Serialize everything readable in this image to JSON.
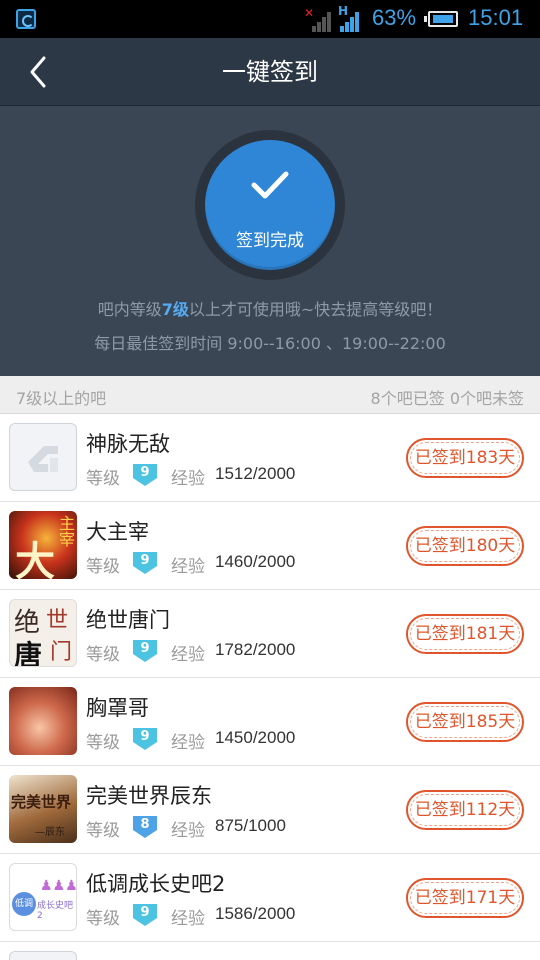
{
  "status_bar": {
    "battery_percent": "63%",
    "time": "15:01",
    "battery_level": 0.63
  },
  "header": {
    "title": "一键签到",
    "back_icon": "chevron-left-icon"
  },
  "hero": {
    "sign_button_label": "签到完成",
    "notice_prefix": "吧内等级",
    "notice_level": "7级",
    "notice_suffix": "以上才可使用哦~快去提高等级吧！",
    "best_time": "每日最佳签到时间  9:00--16:00 、19:00--22:00",
    "accent_color": "#2f86d6"
  },
  "section": {
    "left": "7级以上的吧",
    "right": "8个吧已签 0个吧未签"
  },
  "labels": {
    "level": "等级",
    "exp": "经验"
  },
  "forums": [
    {
      "name": "神脉无敌",
      "level": "9",
      "exp": "1512/2000",
      "status": "已签到183天",
      "badge_color": "#4cc3e3"
    },
    {
      "name": "大主宰",
      "level": "9",
      "exp": "1460/2000",
      "status": "已签到180天",
      "badge_color": "#4cc3e3"
    },
    {
      "name": "绝世唐门",
      "level": "9",
      "exp": "1782/2000",
      "status": "已签到181天",
      "badge_color": "#4cc3e3"
    },
    {
      "name": "胸罩哥",
      "level": "9",
      "exp": "1450/2000",
      "status": "已签到185天",
      "badge_color": "#4cc3e3"
    },
    {
      "name": "完美世界辰东",
      "level": "8",
      "exp": "875/1000",
      "status": "已签到112天",
      "badge_color": "#4da3e6"
    },
    {
      "name": "低调成长史吧2",
      "level": "9",
      "exp": "1586/2000",
      "status": "已签到171天",
      "badge_color": "#4cc3e3"
    }
  ],
  "avatar_text": {
    "a1_big": "大",
    "a1_small": "主宰",
    "a2_left": "绝",
    "a2_top": "世",
    "a2_mid": "唐",
    "a2_right": "门",
    "a4": "完美世界",
    "a4_sign": "—辰东",
    "a5_badge": "低调",
    "a5_text": "成长史吧2"
  },
  "stamp_color": "#e1552c"
}
